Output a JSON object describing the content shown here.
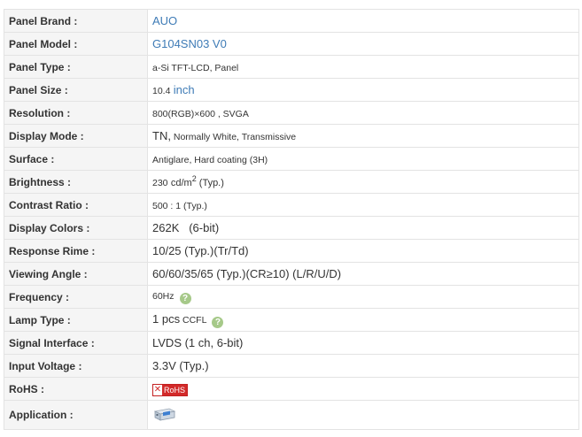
{
  "rows": [
    {
      "label": "Panel Brand :",
      "value": "AUO"
    },
    {
      "label": "Panel Model :",
      "value": "G104SN03 V0"
    },
    {
      "label": "Panel Type :",
      "value": "a-Si TFT-LCD, Panel"
    },
    {
      "label": "Panel Size :",
      "num": "10.4",
      "unit": "inch"
    },
    {
      "label": "Resolution :",
      "value": "800(RGB)×600 , SVGA"
    },
    {
      "label": "Display Mode :",
      "lead": "TN,",
      "rest": " Normally White, Transmissive"
    },
    {
      "label": "Surface :",
      "value": "Antiglare, Hard coating (3H)"
    },
    {
      "label": "Brightness :",
      "num": "230",
      "unit": "cd/m",
      "exp": "2",
      "suffix": " (Typ.)"
    },
    {
      "label": "Contrast Ratio :",
      "value": "500 : 1 (Typ.)"
    },
    {
      "label": "Display Colors :",
      "value": "262K   (6-bit)"
    },
    {
      "label": "Response Rime :",
      "value": "10/25 (Typ.)(Tr/Td)"
    },
    {
      "label": "Viewing Angle :",
      "value": "60/60/35/65 (Typ.)(CR≥10) (L/R/U/D)"
    },
    {
      "label": "Frequency :",
      "value": "60Hz",
      "help_icon": "question-circle-icon"
    },
    {
      "label": "Lamp Type :",
      "lead": "1 pcs",
      "rest": " CCFL",
      "help_icon": "question-circle-icon"
    },
    {
      "label": "Signal Interface :",
      "value": "LVDS (1 ch, 6-bit)"
    },
    {
      "label": "Input Voltage :",
      "value": "3.3V (Typ.)"
    },
    {
      "label": "RoHS :",
      "badge_text": "RoHS",
      "badge_icon": "rohs-x-icon"
    },
    {
      "label": "Application :",
      "icon": "industrial-device-icon"
    }
  ],
  "colors": {
    "link": "#3e7bb6",
    "label_bg": "#f5f5f5",
    "border": "#e3e3e3",
    "help_icon": "#a6c989",
    "rohs_red": "#d22a2a"
  }
}
